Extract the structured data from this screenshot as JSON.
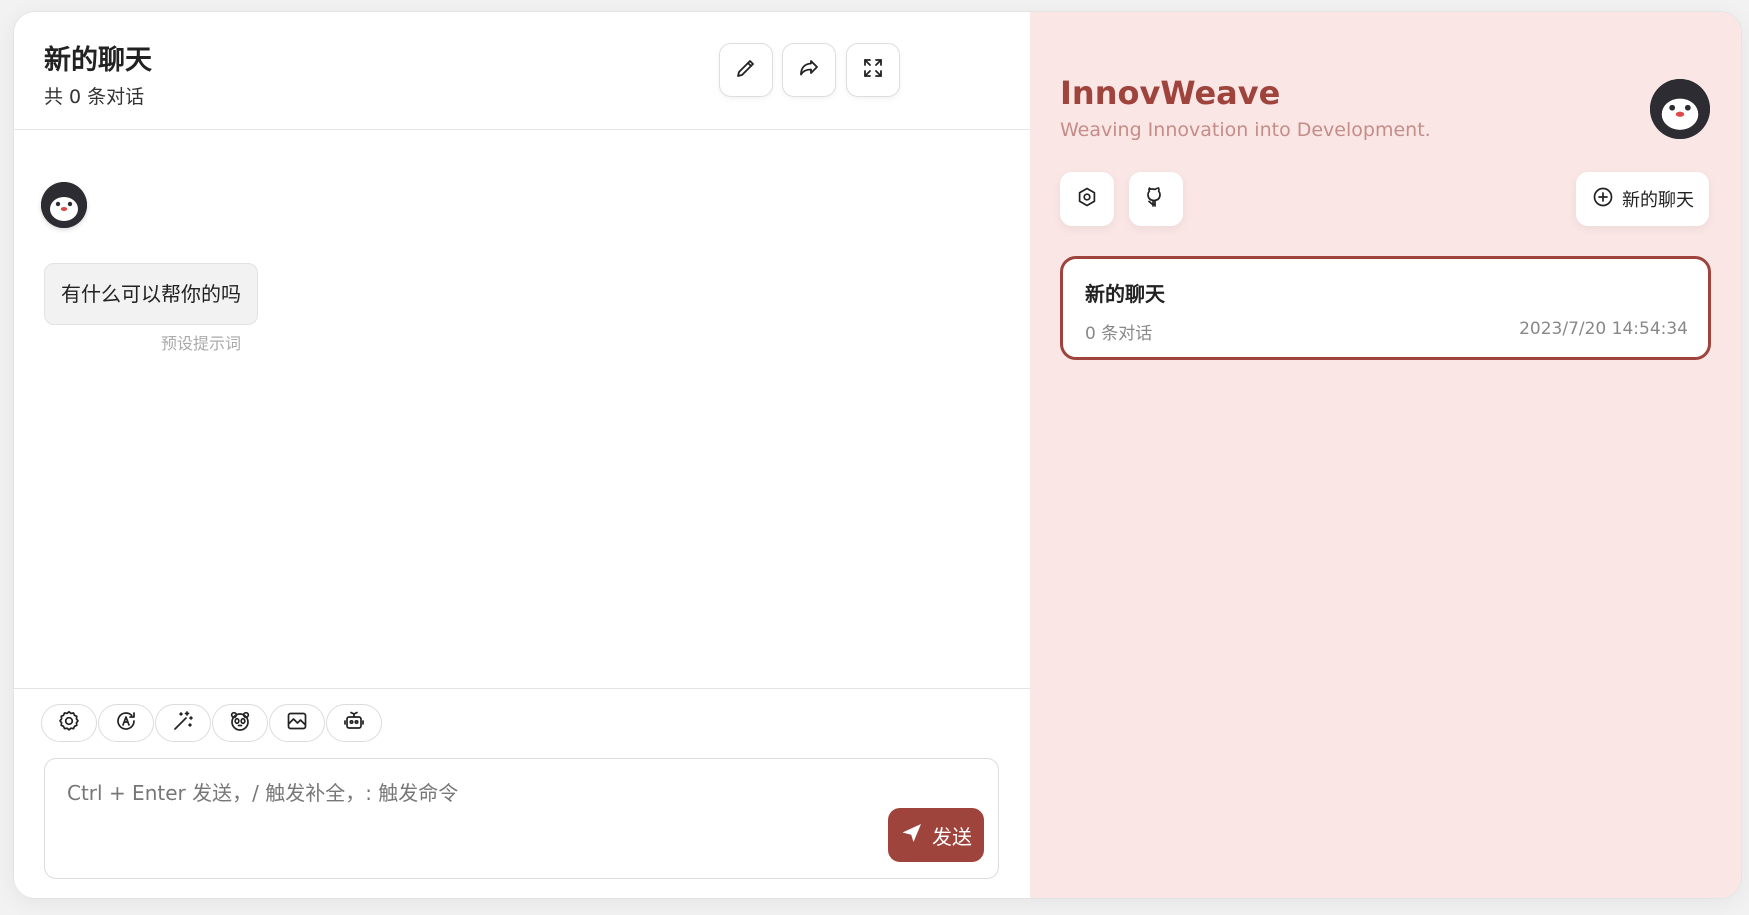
{
  "chat": {
    "title": "新的聊天",
    "subtitle": "共 0 条对话",
    "header_buttons": {
      "edit_icon": "pencil-icon",
      "share_icon": "share-icon",
      "fullscreen_icon": "maximize-icon"
    },
    "messages": [
      {
        "role": "bot",
        "text": "有什么可以帮你的吗",
        "caption": "预设提示词"
      }
    ]
  },
  "toolbar": {
    "tools": [
      "settings-icon",
      "theme-toggle-icon",
      "magic-wand-icon",
      "mask-icon",
      "image-icon",
      "robot-icon"
    ]
  },
  "input": {
    "placeholder": "Ctrl + Enter 发送，/ 触发补全，: 触发命令",
    "value": "",
    "send_label": "发送"
  },
  "sidebar": {
    "title": "InnovWeave",
    "subtitle": "Weaving Innovation into Development.",
    "new_chat_label": "新的聊天",
    "conversations": [
      {
        "title": "新的聊天",
        "count": "0 条对话",
        "time": "2023/7/20 14:54:34"
      }
    ]
  },
  "colors": {
    "accent": "#9e443d",
    "sidebar_bg": "#fbe6e6",
    "subtitle": "#c48d88"
  }
}
